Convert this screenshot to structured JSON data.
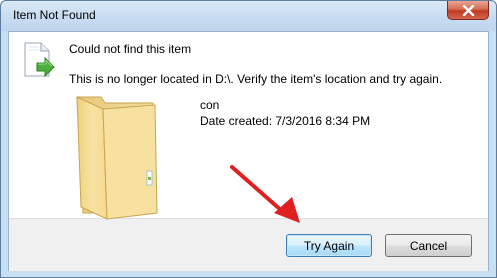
{
  "window": {
    "title": "Item Not Found",
    "close_icon": "close-x-icon"
  },
  "dialog": {
    "main_icon": "file-move-icon",
    "heading": "Could not find this item",
    "message": "This is no longer located in D:\\. Verify the item's location and try again."
  },
  "item": {
    "icon": "folder-icon",
    "name": "con",
    "date_created": "Date created: 7/3/2016 8:34 PM"
  },
  "annotation": {
    "icon": "red-arrow-icon",
    "color": "#e02020"
  },
  "buttons": {
    "try_again": "Try Again",
    "cancel": "Cancel"
  }
}
